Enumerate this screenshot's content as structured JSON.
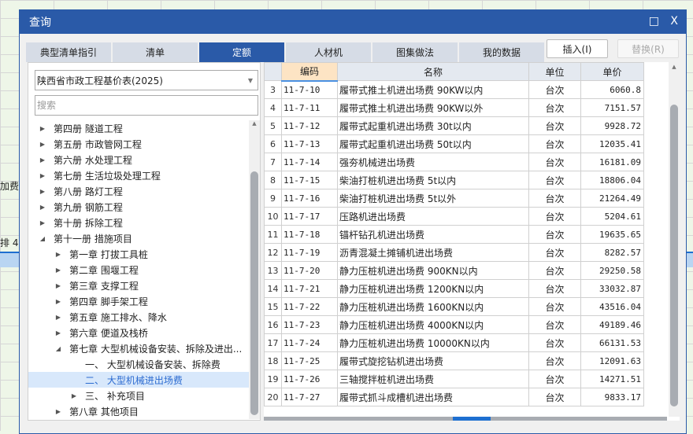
{
  "background": {
    "cell_a": "加费",
    "cell_b": "排 4"
  },
  "dialog": {
    "title": "查询",
    "maximize_icon": "□",
    "close_icon": "X"
  },
  "tabs": [
    {
      "label": "典型清单指引"
    },
    {
      "label": "清单"
    },
    {
      "label": "定额",
      "active": true
    },
    {
      "label": "人材机"
    },
    {
      "label": "图集做法"
    },
    {
      "label": "我的数据"
    }
  ],
  "buttons": {
    "insert": "插入(I)",
    "replace": "替换(R)"
  },
  "left": {
    "library": "陕西省市政工程基价表(2025)",
    "search_placeholder": "搜索",
    "tree": [
      {
        "label": "第四册 隧道工程",
        "level": 0,
        "state": "collapsed"
      },
      {
        "label": "第五册 市政管网工程",
        "level": 0,
        "state": "collapsed"
      },
      {
        "label": "第六册 水处理工程",
        "level": 0,
        "state": "collapsed"
      },
      {
        "label": "第七册 生活垃圾处理工程",
        "level": 0,
        "state": "collapsed"
      },
      {
        "label": "第八册 路灯工程",
        "level": 0,
        "state": "collapsed"
      },
      {
        "label": "第九册 钢筋工程",
        "level": 0,
        "state": "collapsed"
      },
      {
        "label": "第十册 拆除工程",
        "level": 0,
        "state": "collapsed"
      },
      {
        "label": "第十一册 措施项目",
        "level": 0,
        "state": "expanded"
      },
      {
        "label": "第一章 打拔工具桩",
        "level": 1,
        "state": "collapsed"
      },
      {
        "label": "第二章 围堰工程",
        "level": 1,
        "state": "collapsed"
      },
      {
        "label": "第三章 支撑工程",
        "level": 1,
        "state": "collapsed"
      },
      {
        "label": "第四章 脚手架工程",
        "level": 1,
        "state": "collapsed"
      },
      {
        "label": "第五章 施工排水、降水",
        "level": 1,
        "state": "collapsed"
      },
      {
        "label": "第六章 便道及栈桥",
        "level": 1,
        "state": "collapsed"
      },
      {
        "label": "第七章 大型机械设备安装、拆除及进出...",
        "level": 1,
        "state": "expanded"
      },
      {
        "label": "一、  大型机械设备安装、拆除费",
        "level": 2,
        "state": "leaf"
      },
      {
        "label": "二、  大型机械进出场费",
        "level": 2,
        "state": "leaf",
        "selected": true
      },
      {
        "label": "三、  补充项目",
        "level": 2,
        "state": "collapsed"
      },
      {
        "label": "第八章 其他项目",
        "level": 1,
        "state": "collapsed"
      }
    ]
  },
  "table": {
    "headers": {
      "code": "编码",
      "name": "名称",
      "unit": "单位",
      "price": "单价"
    },
    "rows": [
      [
        "3",
        "11-7-10",
        "履带式推土机进出场费 90KW以内",
        "台次",
        "6060.8"
      ],
      [
        "4",
        "11-7-11",
        "履带式推土机进出场费 90KW以外",
        "台次",
        "7151.57"
      ],
      [
        "5",
        "11-7-12",
        "履带式起重机进出场费 30t以内",
        "台次",
        "9928.72"
      ],
      [
        "6",
        "11-7-13",
        "履带式起重机进出场费 50t以内",
        "台次",
        "12035.41"
      ],
      [
        "7",
        "11-7-14",
        "强夯机械进出场费",
        "台次",
        "16181.09"
      ],
      [
        "8",
        "11-7-15",
        "柴油打桩机进出场费 5t以内",
        "台次",
        "18806.04"
      ],
      [
        "9",
        "11-7-16",
        "柴油打桩机进出场费 5t以外",
        "台次",
        "21264.49"
      ],
      [
        "10",
        "11-7-17",
        "压路机进出场费",
        "台次",
        "5204.61"
      ],
      [
        "11",
        "11-7-18",
        "锚杆钻孔机进出场费",
        "台次",
        "19635.65"
      ],
      [
        "12",
        "11-7-19",
        "沥青混凝土摊铺机进出场费",
        "台次",
        "8282.57"
      ],
      [
        "13",
        "11-7-20",
        "静力压桩机进出场费 900KN以内",
        "台次",
        "29250.58"
      ],
      [
        "14",
        "11-7-21",
        "静力压桩机进出场费 1200KN以内",
        "台次",
        "33032.87"
      ],
      [
        "15",
        "11-7-22",
        "静力压桩机进出场费 1600KN以内",
        "台次",
        "43516.04"
      ],
      [
        "16",
        "11-7-23",
        "静力压桩机进出场费 4000KN以内",
        "台次",
        "49189.46"
      ],
      [
        "17",
        "11-7-24",
        "静力压桩机进出场费 10000KN以内",
        "台次",
        "66131.53"
      ],
      [
        "18",
        "11-7-25",
        "履带式旋挖钻机进出场费",
        "台次",
        "12091.63"
      ],
      [
        "19",
        "11-7-26",
        "三轴搅拌桩机进出场费",
        "台次",
        "14271.51"
      ],
      [
        "20",
        "11-7-27",
        "履带式抓斗成槽机进出场费",
        "台次",
        "9833.17"
      ]
    ]
  },
  "colors": {
    "accent": "#2a5aa8",
    "selected_bg": "#d8e8fb",
    "code_header": "#fde4c4"
  }
}
